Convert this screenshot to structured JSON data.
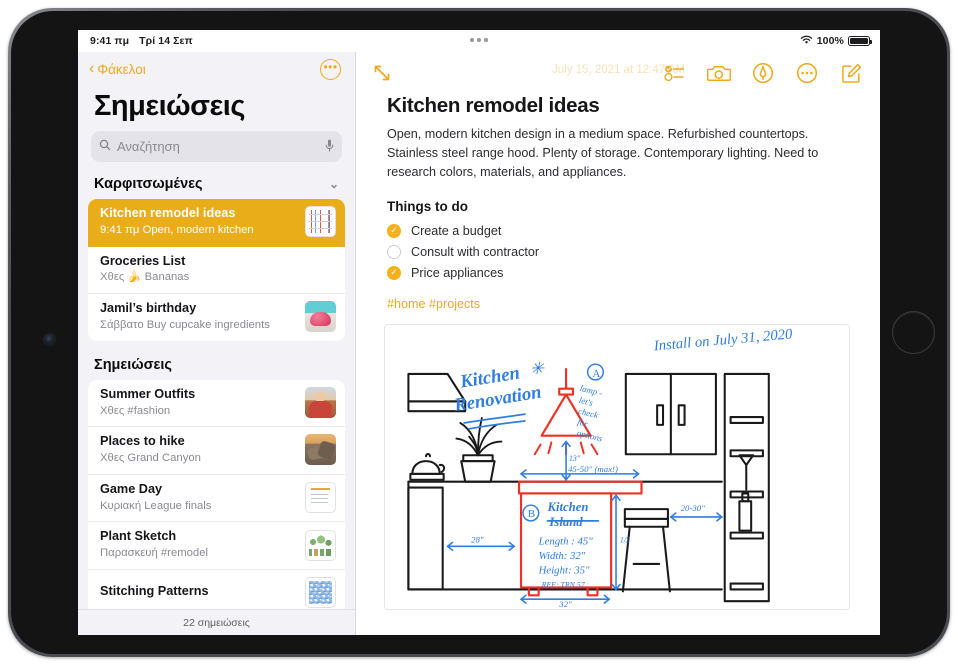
{
  "status_bar": {
    "time": "9:41 πμ",
    "date": "Τρί 14 Σεπ",
    "wifi_icon": "wifi-icon",
    "battery_percent": "100%"
  },
  "sidebar": {
    "back_label": "Φάκελοι",
    "back_icon": "chevron-left-icon",
    "more_icon": "ellipsis-circle-icon",
    "title": "Σημειώσεις",
    "search": {
      "placeholder": "Αναζήτηση",
      "value": "",
      "search_icon": "search-icon",
      "mic_icon": "microphone-icon"
    },
    "sections": [
      {
        "heading": "Καρφιτσωμένες",
        "collapse_icon": "chevron-down-icon",
        "notes": [
          {
            "title": "Kitchen remodel ideas",
            "subtitle": "9:41 πμ  Open, modern kitchen",
            "thumb": "th-sketch",
            "selected": true
          },
          {
            "title": "Groceries List",
            "subtitle": "Χθες 🍌 Bananas",
            "thumb": "",
            "selected": false
          },
          {
            "title": "Jamil’s birthday",
            "subtitle": "Σάββατο Buy cupcake ingredients",
            "thumb": "th-cake",
            "selected": false
          }
        ]
      },
      {
        "heading": "Σημειώσεις",
        "collapse_icon": "",
        "notes": [
          {
            "title": "Summer Outfits",
            "subtitle": "Χθες #fashion",
            "thumb": "th-person",
            "selected": false
          },
          {
            "title": "Places to hike",
            "subtitle": "Χθες Grand Canyon",
            "thumb": "th-rocks",
            "selected": false
          },
          {
            "title": "Game Day",
            "subtitle": "Κυριακή League finals",
            "thumb": "th-doc",
            "selected": false
          },
          {
            "title": "Plant Sketch",
            "subtitle": "Παρασκευή #remodel",
            "thumb": "th-plants",
            "selected": false
          },
          {
            "title": "Stitching Patterns",
            "subtitle": "",
            "thumb": "th-stitch",
            "selected": false
          }
        ]
      }
    ],
    "footer": "22 σημειώσεις"
  },
  "detail": {
    "expand_icon": "expand-diagonal-icon",
    "toolbar_icons": [
      "checklist-icon",
      "camera-icon",
      "markup-pen-icon",
      "ellipsis-circle-icon",
      "compose-icon"
    ],
    "date_stamp": "July 15, 2021 at 12:47 AM",
    "title": "Kitchen remodel ideas",
    "description": "Open, modern kitchen design in a medium space. Refurbished countertops. Stainless steel range hood. Plenty of storage. Contemporary lighting. Need to research colors, materials, and appliances.",
    "todo_heading": "Things to do",
    "todos": [
      {
        "label": "Create a budget",
        "done": true
      },
      {
        "label": "Consult with contractor",
        "done": false
      },
      {
        "label": "Price appliances",
        "done": true
      }
    ],
    "tags": "#home #projects",
    "sketch": {
      "title_handwritten": "Kitchen Renovation",
      "install_note": "Install on July 31, 2020",
      "lamp_marker": "A",
      "lamp_note": "lamp - let's check for options",
      "lamp_drop_dim": "13\"",
      "counter_span_dim": "45-50\" (max!)",
      "left_gap_dim": "28\"",
      "island_marker": "B",
      "island_label": "Kitchen Island",
      "island_length": "Length : 45\"",
      "island_width": "Width: 32\"",
      "island_height": "Height: 35\"",
      "island_ref": "REF: TRN 57",
      "island_height_dim": "1/2",
      "island_width_dim": "32\"",
      "stool_gap_dim": "20-30\""
    }
  },
  "colors": {
    "accent": "#f0a91e",
    "selected_row": "#e8ad19",
    "sidebar_bg": "#f3f2f7",
    "sketch_blue": "#2f7de1",
    "sketch_red": "#ee3124"
  }
}
